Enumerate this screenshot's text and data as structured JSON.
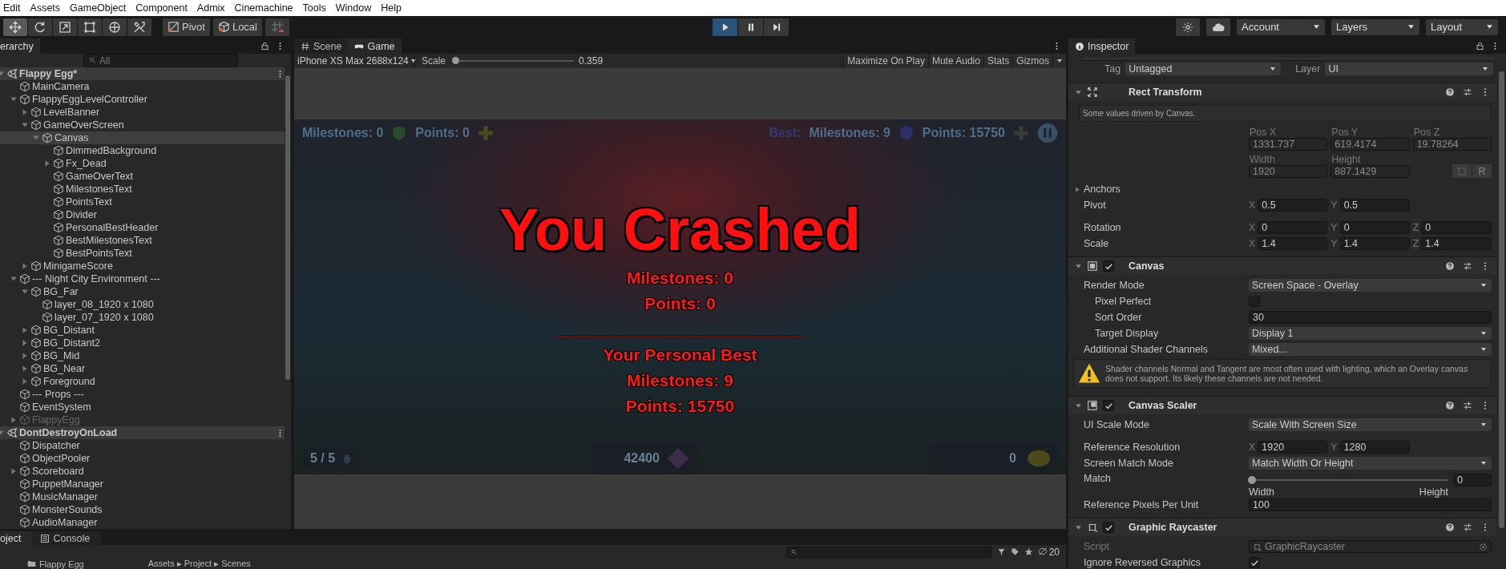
{
  "menu_bar": [
    "Edit",
    "Assets",
    "GameObject",
    "Component",
    "Admix",
    "Cinemachine",
    "Tools",
    "Window",
    "Help"
  ],
  "toolbar": {
    "tools": [
      {
        "kind": "move",
        "selected": true
      },
      {
        "kind": "rotate",
        "selected": false
      },
      {
        "kind": "scale",
        "selected": false
      },
      {
        "kind": "rect",
        "selected": false
      },
      {
        "kind": "transform",
        "selected": false
      },
      {
        "kind": "custom",
        "selected": false
      }
    ],
    "handle_position": "Pivot",
    "handle_rotation": "Local",
    "playback": [
      {
        "kind": "play",
        "selected": true
      },
      {
        "kind": "pause",
        "selected": false
      },
      {
        "kind": "step",
        "selected": false
      }
    ],
    "account": "Account",
    "layers": "Layers",
    "layout": "Layout"
  },
  "hierarchy": {
    "tab": "erarchy",
    "search_placeholder": "All",
    "scenes": [
      {
        "name": "Flappy Egg*",
        "children": [
          {
            "name": "MainCamera",
            "selected": false,
            "disabled": false
          },
          {
            "name": "FlappyEggLevelController",
            "expanded": true,
            "selected": false,
            "disabled": false,
            "children": [
              {
                "name": "LevelBanner",
                "expanded": false,
                "selected": false,
                "disabled": false
              },
              {
                "name": "GameOverScreen",
                "expanded": true,
                "selected": false,
                "disabled": false,
                "children": [
                  {
                    "name": "Canvas",
                    "expanded": true,
                    "selected": true,
                    "disabled": false,
                    "children": [
                      {
                        "name": "DimmedBackground",
                        "selected": false,
                        "disabled": false
                      },
                      {
                        "name": "Fx_Dead",
                        "expanded": false,
                        "selected": false,
                        "disabled": false
                      },
                      {
                        "name": "GameOverText",
                        "selected": false,
                        "disabled": false
                      },
                      {
                        "name": "MilestonesText",
                        "selected": false,
                        "disabled": false
                      },
                      {
                        "name": "PointsText",
                        "selected": false,
                        "disabled": false
                      },
                      {
                        "name": "Divider",
                        "selected": false,
                        "disabled": false
                      },
                      {
                        "name": "PersonalBestHeader",
                        "selected": false,
                        "disabled": false
                      },
                      {
                        "name": "BestMilestonesText",
                        "selected": false,
                        "disabled": false
                      },
                      {
                        "name": "BestPointsText",
                        "selected": false,
                        "disabled": false
                      }
                    ]
                  }
                ]
              },
              {
                "name": "MinigameScore",
                "expanded": false,
                "selected": false,
                "disabled": false
              }
            ]
          },
          {
            "name": "--- Night City Environment ---",
            "expanded": true,
            "selected": false,
            "disabled": false,
            "children": [
              {
                "name": "BG_Far",
                "expanded": true,
                "selected": false,
                "disabled": false,
                "children": [
                  {
                    "name": "layer_08_1920 x 1080",
                    "selected": false,
                    "disabled": false
                  },
                  {
                    "name": "layer_07_1920 x 1080",
                    "selected": false,
                    "disabled": false
                  }
                ]
              },
              {
                "name": "BG_Distant",
                "expanded": false,
                "selected": false,
                "disabled": false
              },
              {
                "name": "BG_Distant2",
                "expanded": false,
                "selected": false,
                "disabled": false
              },
              {
                "name": "BG_Mid",
                "expanded": false,
                "selected": false,
                "disabled": false
              },
              {
                "name": "BG_Near",
                "expanded": false,
                "selected": false,
                "disabled": false
              },
              {
                "name": "Foreground",
                "expanded": false,
                "selected": false,
                "disabled": false
              }
            ]
          },
          {
            "name": "--- Props ---",
            "selected": false,
            "disabled": false
          },
          {
            "name": "EventSystem",
            "selected": false,
            "disabled": false
          },
          {
            "name": "FlappyEgg",
            "expanded": false,
            "selected": false,
            "disabled": true
          }
        ]
      },
      {
        "name": "DontDestroyOnLoad",
        "children": [
          {
            "name": "Dispatcher",
            "selected": false,
            "disabled": false
          },
          {
            "name": "ObjectPooler",
            "selected": false,
            "disabled": false
          },
          {
            "name": "Scoreboard",
            "expanded": false,
            "selected": false,
            "disabled": false
          },
          {
            "name": "PuppetManager",
            "selected": false,
            "disabled": false
          },
          {
            "name": "MusicManager",
            "selected": false,
            "disabled": false
          },
          {
            "name": "MonsterSounds",
            "selected": false,
            "disabled": false
          },
          {
            "name": "AudioManager",
            "selected": false,
            "disabled": false
          }
        ]
      }
    ]
  },
  "game_view": {
    "tabs": [
      {
        "label": "Scene",
        "kind": "scene",
        "selected": false
      },
      {
        "label": "Game",
        "kind": "game",
        "selected": true
      }
    ],
    "resolution": "iPhone XS Max 2688x124",
    "scale_label": "Scale",
    "scale": {
      "level": 0
    },
    "scale_value": "0.359",
    "toggles": [
      "Maximize On Play",
      "Mute Audio",
      "Stats",
      "Gizmos"
    ],
    "hud": {
      "milestones": "Milestones: 0",
      "points": "Points: 0",
      "best_label": "Best:",
      "best_milestones": "Milestones: 9",
      "best_points": "Points: 15750",
      "lives": "5 / 5",
      "coins": "42400",
      "gems": "0"
    },
    "overlay": {
      "title": "You Crashed",
      "lines": [
        "Milestones: 0",
        "Points: 0",
        "__________________________",
        "Your Personal Best",
        "Milestones: 9",
        "Points: 15750"
      ]
    }
  },
  "bottom_panel": {
    "tabs": [
      {
        "label": "oject",
        "selected": true
      },
      {
        "label": "Console",
        "selected": false
      }
    ],
    "count": "20",
    "folder": "Flappy Egg",
    "breadcrumb": "Assets ▸ Project ▸ Scenes"
  },
  "inspector": {
    "tab": "Inspector",
    "tag_label": "Tag",
    "tag": "Untagged",
    "layer_label": "Layer",
    "layer": "UI",
    "components": [
      {
        "kind": "rect_transform",
        "title": "Rect Transform",
        "rows": [
          {
            "kind": "note",
            "text": "Some values driven by Canvas."
          },
          {
            "kind": "grid",
            "cells": [
              {
                "label": "Pos X",
                "value": "1331.737"
              },
              {
                "label": "Pos Y",
                "value": "619.4174"
              },
              {
                "label": "Pos Z",
                "value": "19.78264"
              }
            ]
          },
          {
            "kind": "grid",
            "cells": [
              {
                "label": "Width",
                "value": "1920"
              },
              {
                "label": "Height",
                "value": "887.1429"
              }
            ],
            "button": "R"
          },
          {
            "kind": "foldout",
            "label": "Anchors",
            "expanded": false
          },
          {
            "kind": "vector",
            "label": "Pivot",
            "axes": [
              {
                "axis": "X",
                "value": "0.5"
              },
              {
                "axis": "Y",
                "value": "0.5"
              }
            ]
          },
          {
            "kind": "vector",
            "label": "Rotation",
            "axes": [
              {
                "axis": "X",
                "value": "0"
              },
              {
                "axis": "Y",
                "value": "0"
              },
              {
                "axis": "Z",
                "value": "0"
              }
            ]
          },
          {
            "kind": "vector",
            "label": "Scale",
            "axes": [
              {
                "axis": "X",
                "value": "1.4"
              },
              {
                "axis": "Y",
                "value": "1.4"
              },
              {
                "axis": "Z",
                "value": "1.4"
              }
            ]
          }
        ]
      },
      {
        "kind": "canvas",
        "title": "Canvas",
        "enabled": true,
        "rows": [
          {
            "kind": "dropdown",
            "label": "Render Mode",
            "value": "Screen Space - Overlay"
          },
          {
            "kind": "checkbox",
            "label": "Pixel Perfect",
            "checked": false,
            "indented": true
          },
          {
            "kind": "field",
            "label": "Sort Order",
            "value": "30",
            "indented": true
          },
          {
            "kind": "dropdown",
            "label": "Target Display",
            "value": "Display 1",
            "indented": true
          },
          {
            "kind": "dropdown",
            "label": "Additional Shader Channels",
            "value": "Mixed..."
          },
          {
            "kind": "warning",
            "text": "Shader channels Normal and Tangent are most often used with lighting, which an Overlay canvas does not support. Its likely these channels are not needed."
          }
        ]
      },
      {
        "kind": "canvas_scaler",
        "title": "Canvas Scaler",
        "enabled": true,
        "rows": [
          {
            "kind": "dropdown",
            "label": "UI Scale Mode",
            "value": "Scale With Screen Size"
          },
          {
            "kind": "vector",
            "label": "Reference Resolution",
            "axes": [
              {
                "axis": "X",
                "value": "1920"
              },
              {
                "axis": "Y",
                "value": "1280"
              }
            ]
          },
          {
            "kind": "dropdown",
            "label": "Screen Match Mode",
            "value": "Match Width Or Height"
          },
          {
            "kind": "slider",
            "label": "Match",
            "level": 0,
            "value": "0",
            "min_label": "Width",
            "max_label": "Height"
          },
          {
            "kind": "field",
            "label": "Reference Pixels Per Unit",
            "value": "100"
          }
        ]
      },
      {
        "kind": "graphic_raycaster",
        "title": "Graphic Raycaster",
        "enabled": true,
        "rows": [
          {
            "kind": "object",
            "label": "Script",
            "value": "GraphicRaycaster"
          },
          {
            "kind": "checkbox",
            "label": "Ignore Reversed Graphics",
            "checked": true
          }
        ]
      }
    ]
  }
}
